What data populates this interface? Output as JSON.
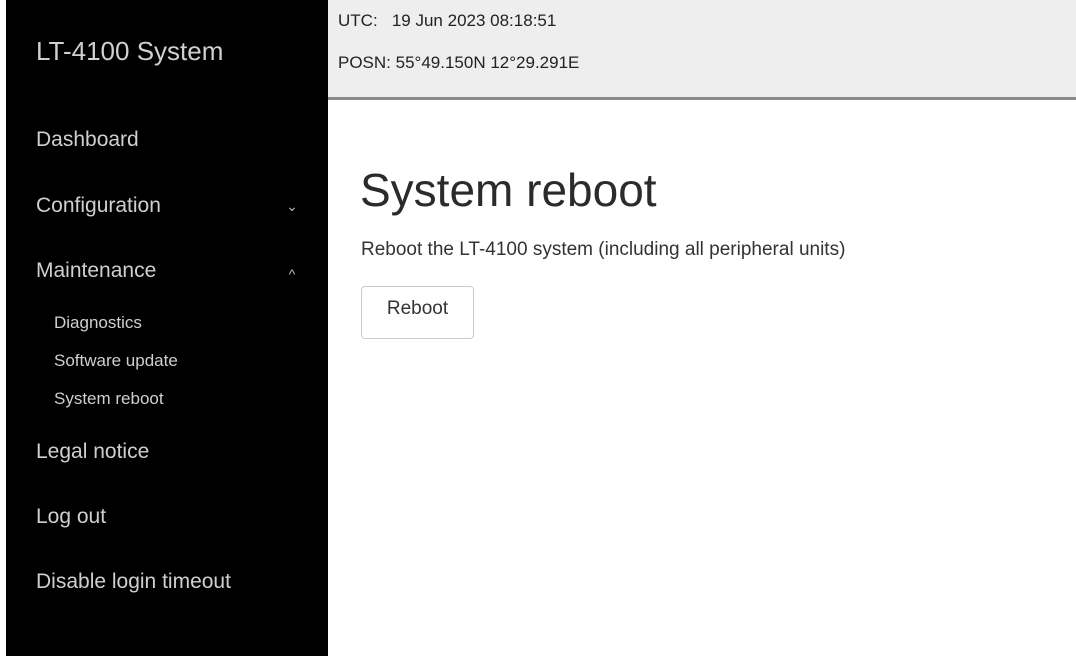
{
  "sidebar": {
    "brand": "LT-4100 System",
    "items": [
      {
        "label": "Dashboard"
      },
      {
        "label": "Configuration",
        "chevron": "⌄"
      },
      {
        "label": "Maintenance",
        "chevron": "^",
        "subitems": [
          {
            "label": "Diagnostics"
          },
          {
            "label": "Software update"
          },
          {
            "label": "System reboot"
          }
        ]
      },
      {
        "label": "Legal notice"
      },
      {
        "label": "Log out"
      },
      {
        "label": "Disable login timeout"
      }
    ]
  },
  "status": {
    "utc_label": "UTC:",
    "utc_value": "19 Jun 2023 08:18:51",
    "posn_label": "POSN:",
    "posn_value": "55°49.150N 12°29.291E"
  },
  "main": {
    "title": "System reboot",
    "description": "Reboot the LT-4100 system (including all peripheral units)",
    "reboot_button": "Reboot"
  },
  "colors": {
    "sidebar_bg": "#000000",
    "topbar_bg": "#eeeeee",
    "topbar_border": "#8a8a8a"
  }
}
